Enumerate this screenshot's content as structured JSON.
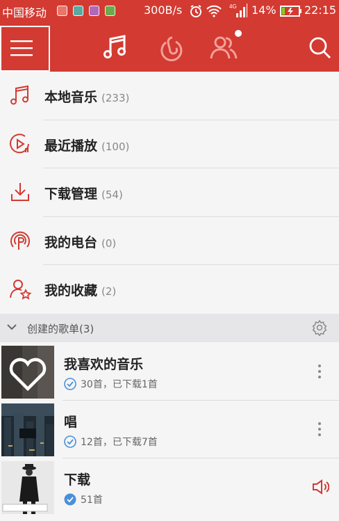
{
  "status_bar": {
    "carrier": "中国移动",
    "speed": "300B/s",
    "network": "4G",
    "battery_percent": "14%",
    "time": "22:15"
  },
  "app_bar": {
    "tabs": [
      {
        "icon": "music-note-icon",
        "active": true
      },
      {
        "icon": "netease-discover-icon",
        "active": false
      },
      {
        "icon": "friends-icon",
        "active": false
      }
    ]
  },
  "menu": {
    "items": [
      {
        "label": "本地音乐",
        "count": "(233)",
        "icon": "music-note-icon"
      },
      {
        "label": "最近播放",
        "count": "(100)",
        "icon": "play-clock-icon"
      },
      {
        "label": "下载管理",
        "count": "(54)",
        "icon": "download-icon"
      },
      {
        "label": "我的电台",
        "count": "(0)",
        "icon": "radio-icon"
      },
      {
        "label": "我的收藏",
        "count": "(2)",
        "icon": "user-star-icon"
      }
    ]
  },
  "section": {
    "title": "创建的歌单(3)"
  },
  "playlists": [
    {
      "name": "我喜欢的音乐",
      "subtitle": "30首，已下载1首"
    },
    {
      "name": "唱",
      "subtitle": "12首，已下载7首"
    },
    {
      "name": "下载",
      "subtitle": "51首"
    }
  ],
  "colors": {
    "brand_red": "#d33a31",
    "check_blue": "#4a90d9",
    "background": "#f5f5f6"
  }
}
